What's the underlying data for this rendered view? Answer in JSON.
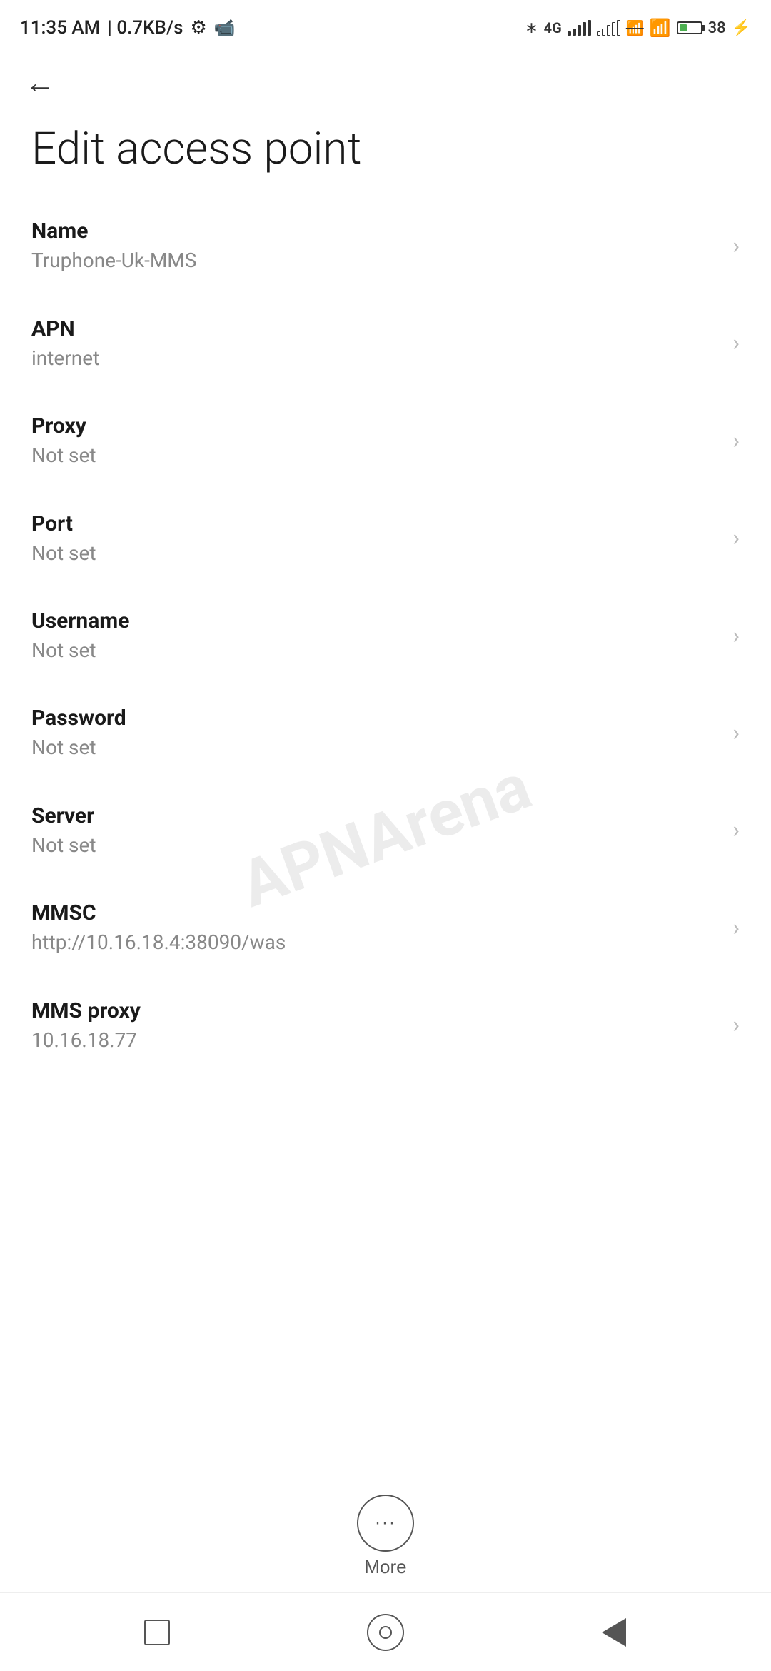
{
  "statusBar": {
    "time": "11:35 AM",
    "speed": "0.7KB/s"
  },
  "header": {
    "backLabel": "←",
    "title": "Edit access point"
  },
  "settings": [
    {
      "label": "Name",
      "value": "Truphone-Uk-MMS"
    },
    {
      "label": "APN",
      "value": "internet"
    },
    {
      "label": "Proxy",
      "value": "Not set"
    },
    {
      "label": "Port",
      "value": "Not set"
    },
    {
      "label": "Username",
      "value": "Not set"
    },
    {
      "label": "Password",
      "value": "Not set"
    },
    {
      "label": "Server",
      "value": "Not set"
    },
    {
      "label": "MMSC",
      "value": "http://10.16.18.4:38090/was"
    },
    {
      "label": "MMS proxy",
      "value": "10.16.18.77"
    }
  ],
  "more": {
    "label": "More"
  },
  "watermark": "APNArena"
}
